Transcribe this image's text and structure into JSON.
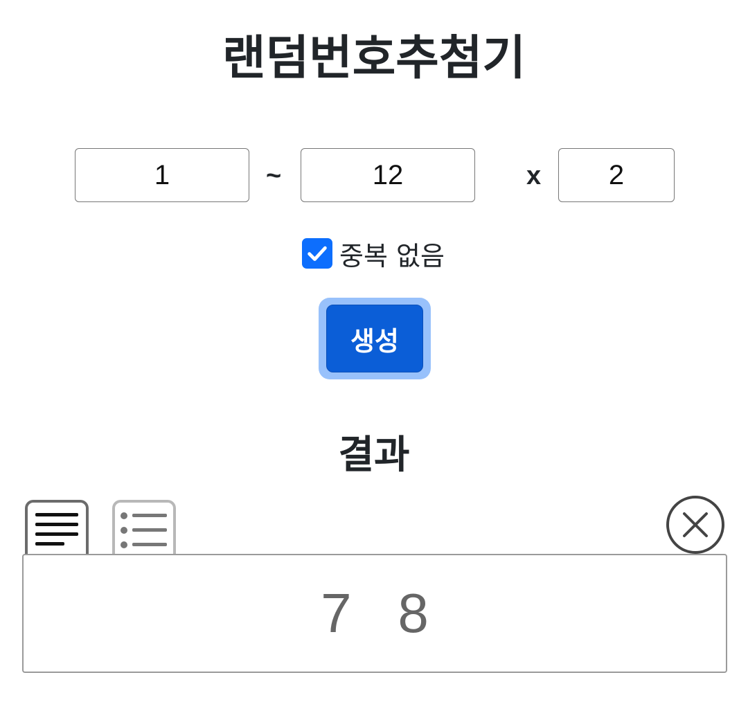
{
  "app": {
    "title": "랜덤번호추첨기"
  },
  "range": {
    "from_value": "1",
    "tilde": "~",
    "to_value": "12",
    "times": "x",
    "count_value": "2"
  },
  "options": {
    "no_duplicate_label": "중복 없음",
    "no_duplicate_checked": true
  },
  "actions": {
    "generate_label": "생성"
  },
  "result": {
    "heading": "결과",
    "text": "7   8",
    "views": [
      "text-view-icon",
      "list-view-icon"
    ],
    "clear_icon": "close-circle-icon"
  },
  "colors": {
    "accent": "#0b5ed7",
    "accent_focus_ring": "#98c1fb",
    "checkbox": "#0d6efd"
  }
}
